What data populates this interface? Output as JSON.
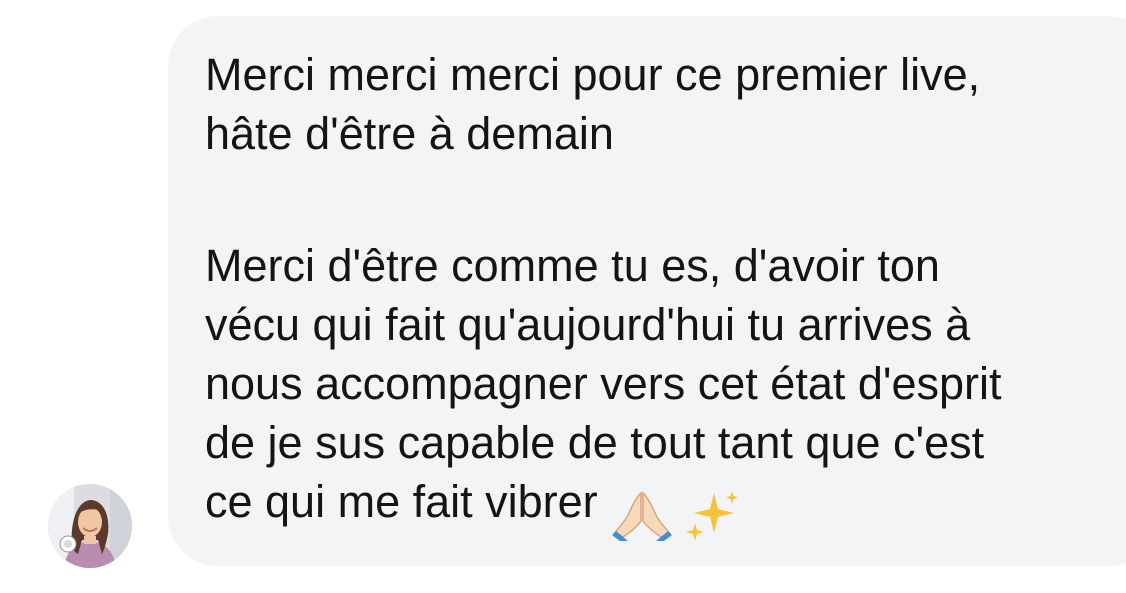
{
  "message": {
    "paragraph_1": [
      "Merci merci merci pour ce premier live,",
      "hâte d'être à demain"
    ],
    "paragraph_2": [
      "Merci d'être comme tu es, d'avoir ton",
      "vécu qui fait qu'aujourd'hui tu arrives à",
      "nous accompagner vers cet état d'esprit",
      "de je sus capable de tout tant que c'est",
      "ce qui me fait vibrer"
    ],
    "emojis": [
      "praying-hands-icon",
      "sparkles-icon"
    ]
  },
  "colors": {
    "bubble_bg": "#f3f4f6",
    "text": "#141414",
    "page_bg": "#ffffff"
  }
}
